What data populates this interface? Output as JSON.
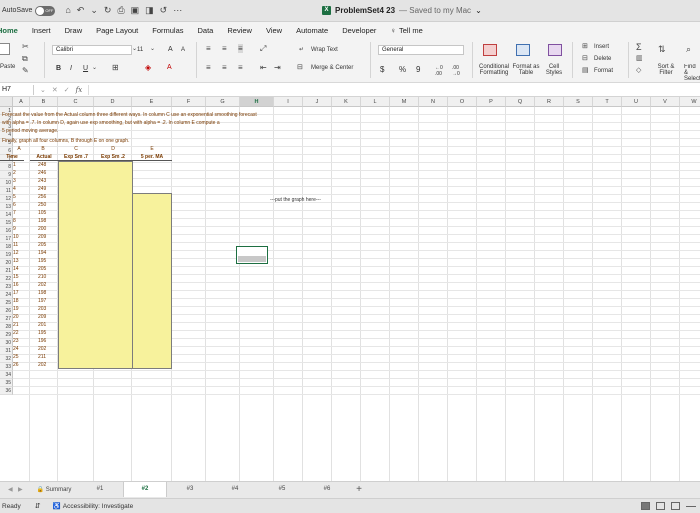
{
  "window": {
    "autosave_label": "AutoSave",
    "autosave_state": "OFF",
    "doc_name": "ProblemSet4 23",
    "doc_status": "— Saved to my Mac",
    "app_icon_letter": "X"
  },
  "ribbon_tabs": [
    {
      "label": "Home",
      "active": true
    },
    {
      "label": "Insert"
    },
    {
      "label": "Draw"
    },
    {
      "label": "Page Layout"
    },
    {
      "label": "Formulas"
    },
    {
      "label": "Data"
    },
    {
      "label": "Review"
    },
    {
      "label": "View"
    },
    {
      "label": "Automate"
    },
    {
      "label": "Developer"
    }
  ],
  "tell_me": "Tell me",
  "ribbon": {
    "paste": "Paste",
    "font_name": "Calibri",
    "font_size": "11",
    "bold": "B",
    "italic": "I",
    "underline": "U",
    "wrap_text": "Wrap Text",
    "merge_center": "Merge & Center",
    "number_format": "General",
    "currency": "$",
    "percent": "%",
    "comma": "9",
    "conditional_formatting": "Conditional Formatting",
    "format_as_table": "Format as Table",
    "cell_styles": "Cell Styles",
    "insert": "Insert",
    "delete": "Delete",
    "format": "Format",
    "sort_filter": "Sort & Filter",
    "find_select": "Find & Select"
  },
  "formula_bar": {
    "name_box": "H7",
    "fx": "fx",
    "value": ""
  },
  "columns": [
    "A",
    "B",
    "C",
    "D",
    "E",
    "F",
    "G",
    "H",
    "I",
    "J",
    "K",
    "L",
    "M",
    "N",
    "O",
    "P",
    "Q",
    "R",
    "S",
    "T",
    "U",
    "V",
    "W"
  ],
  "selected_column": "H",
  "instructions": [
    "Forecast the value from the Actual column three different ways.  In column C use an exponential smoothing forecast",
    "with alpha = .7.  In column D, again use exp smoothing, but with alpha = .2.  In column E compute a",
    "5 period moving average.",
    "Finally, graph all four columns, B through E on one graph."
  ],
  "table": {
    "letters": [
      "A",
      "B",
      "C",
      "D",
      "E"
    ],
    "headers": [
      "Time",
      "Actual",
      "Exp Sm .7",
      "Exp Sm .2",
      "5 per. MA"
    ],
    "times": [
      "1",
      "2",
      "3",
      "4",
      "5",
      "6",
      "7",
      "8",
      "9",
      "10",
      "11",
      "12",
      "13",
      "14",
      "15",
      "16",
      "17",
      "18",
      "19",
      "20",
      "21",
      "22",
      "23",
      "24",
      "25",
      "26"
    ],
    "actuals": [
      "248",
      "246",
      "243",
      "249",
      "256",
      "250",
      "105",
      "198",
      "200",
      "209",
      "205",
      "194",
      "195",
      "205",
      "210",
      "202",
      "198",
      "197",
      "203",
      "209",
      "201",
      "195",
      "196",
      "202",
      "211",
      "202"
    ]
  },
  "graph_placeholder": "---put the graph here---",
  "row_count": 36,
  "sheets": [
    {
      "label": "Summary",
      "locked": true
    },
    {
      "label": "#1"
    },
    {
      "label": "#2",
      "active": true
    },
    {
      "label": "#3"
    },
    {
      "label": "#4"
    },
    {
      "label": "#5"
    },
    {
      "label": "#6"
    }
  ],
  "add_sheet": "+",
  "status": {
    "ready": "Ready",
    "accessibility": "Accessibility: Investigate"
  }
}
